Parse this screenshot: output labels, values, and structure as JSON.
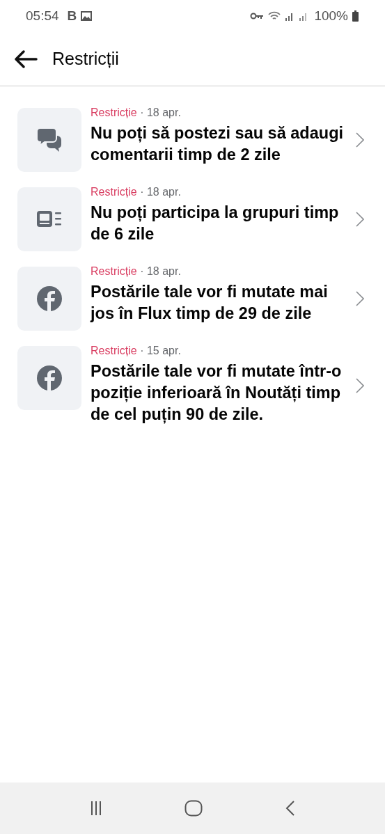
{
  "status_bar": {
    "time": "05:54",
    "app_letter": "B",
    "battery": "100%"
  },
  "header": {
    "title": "Restricții"
  },
  "items": [
    {
      "kind": "comments",
      "category": "Restricție",
      "date": "· 18 apr.",
      "text": "Nu poți să postezi sau să adaugi comentarii timp de 2 zile"
    },
    {
      "kind": "groups",
      "category": "Restricție",
      "date": "· 18 apr.",
      "text": "Nu poți participa la grupuri timp de 6 zile"
    },
    {
      "kind": "circle-f",
      "category": "Restricție",
      "date": "· 18 apr.",
      "text": "Postările tale vor fi mutate mai jos în Flux timp de 29 de zile"
    },
    {
      "kind": "circle-f",
      "category": "Restricție",
      "date": "· 15 apr.",
      "text": "Postările tale vor fi mutate într-o poziție inferioară în Noutăți timp de cel puțin 90 de zile."
    }
  ]
}
